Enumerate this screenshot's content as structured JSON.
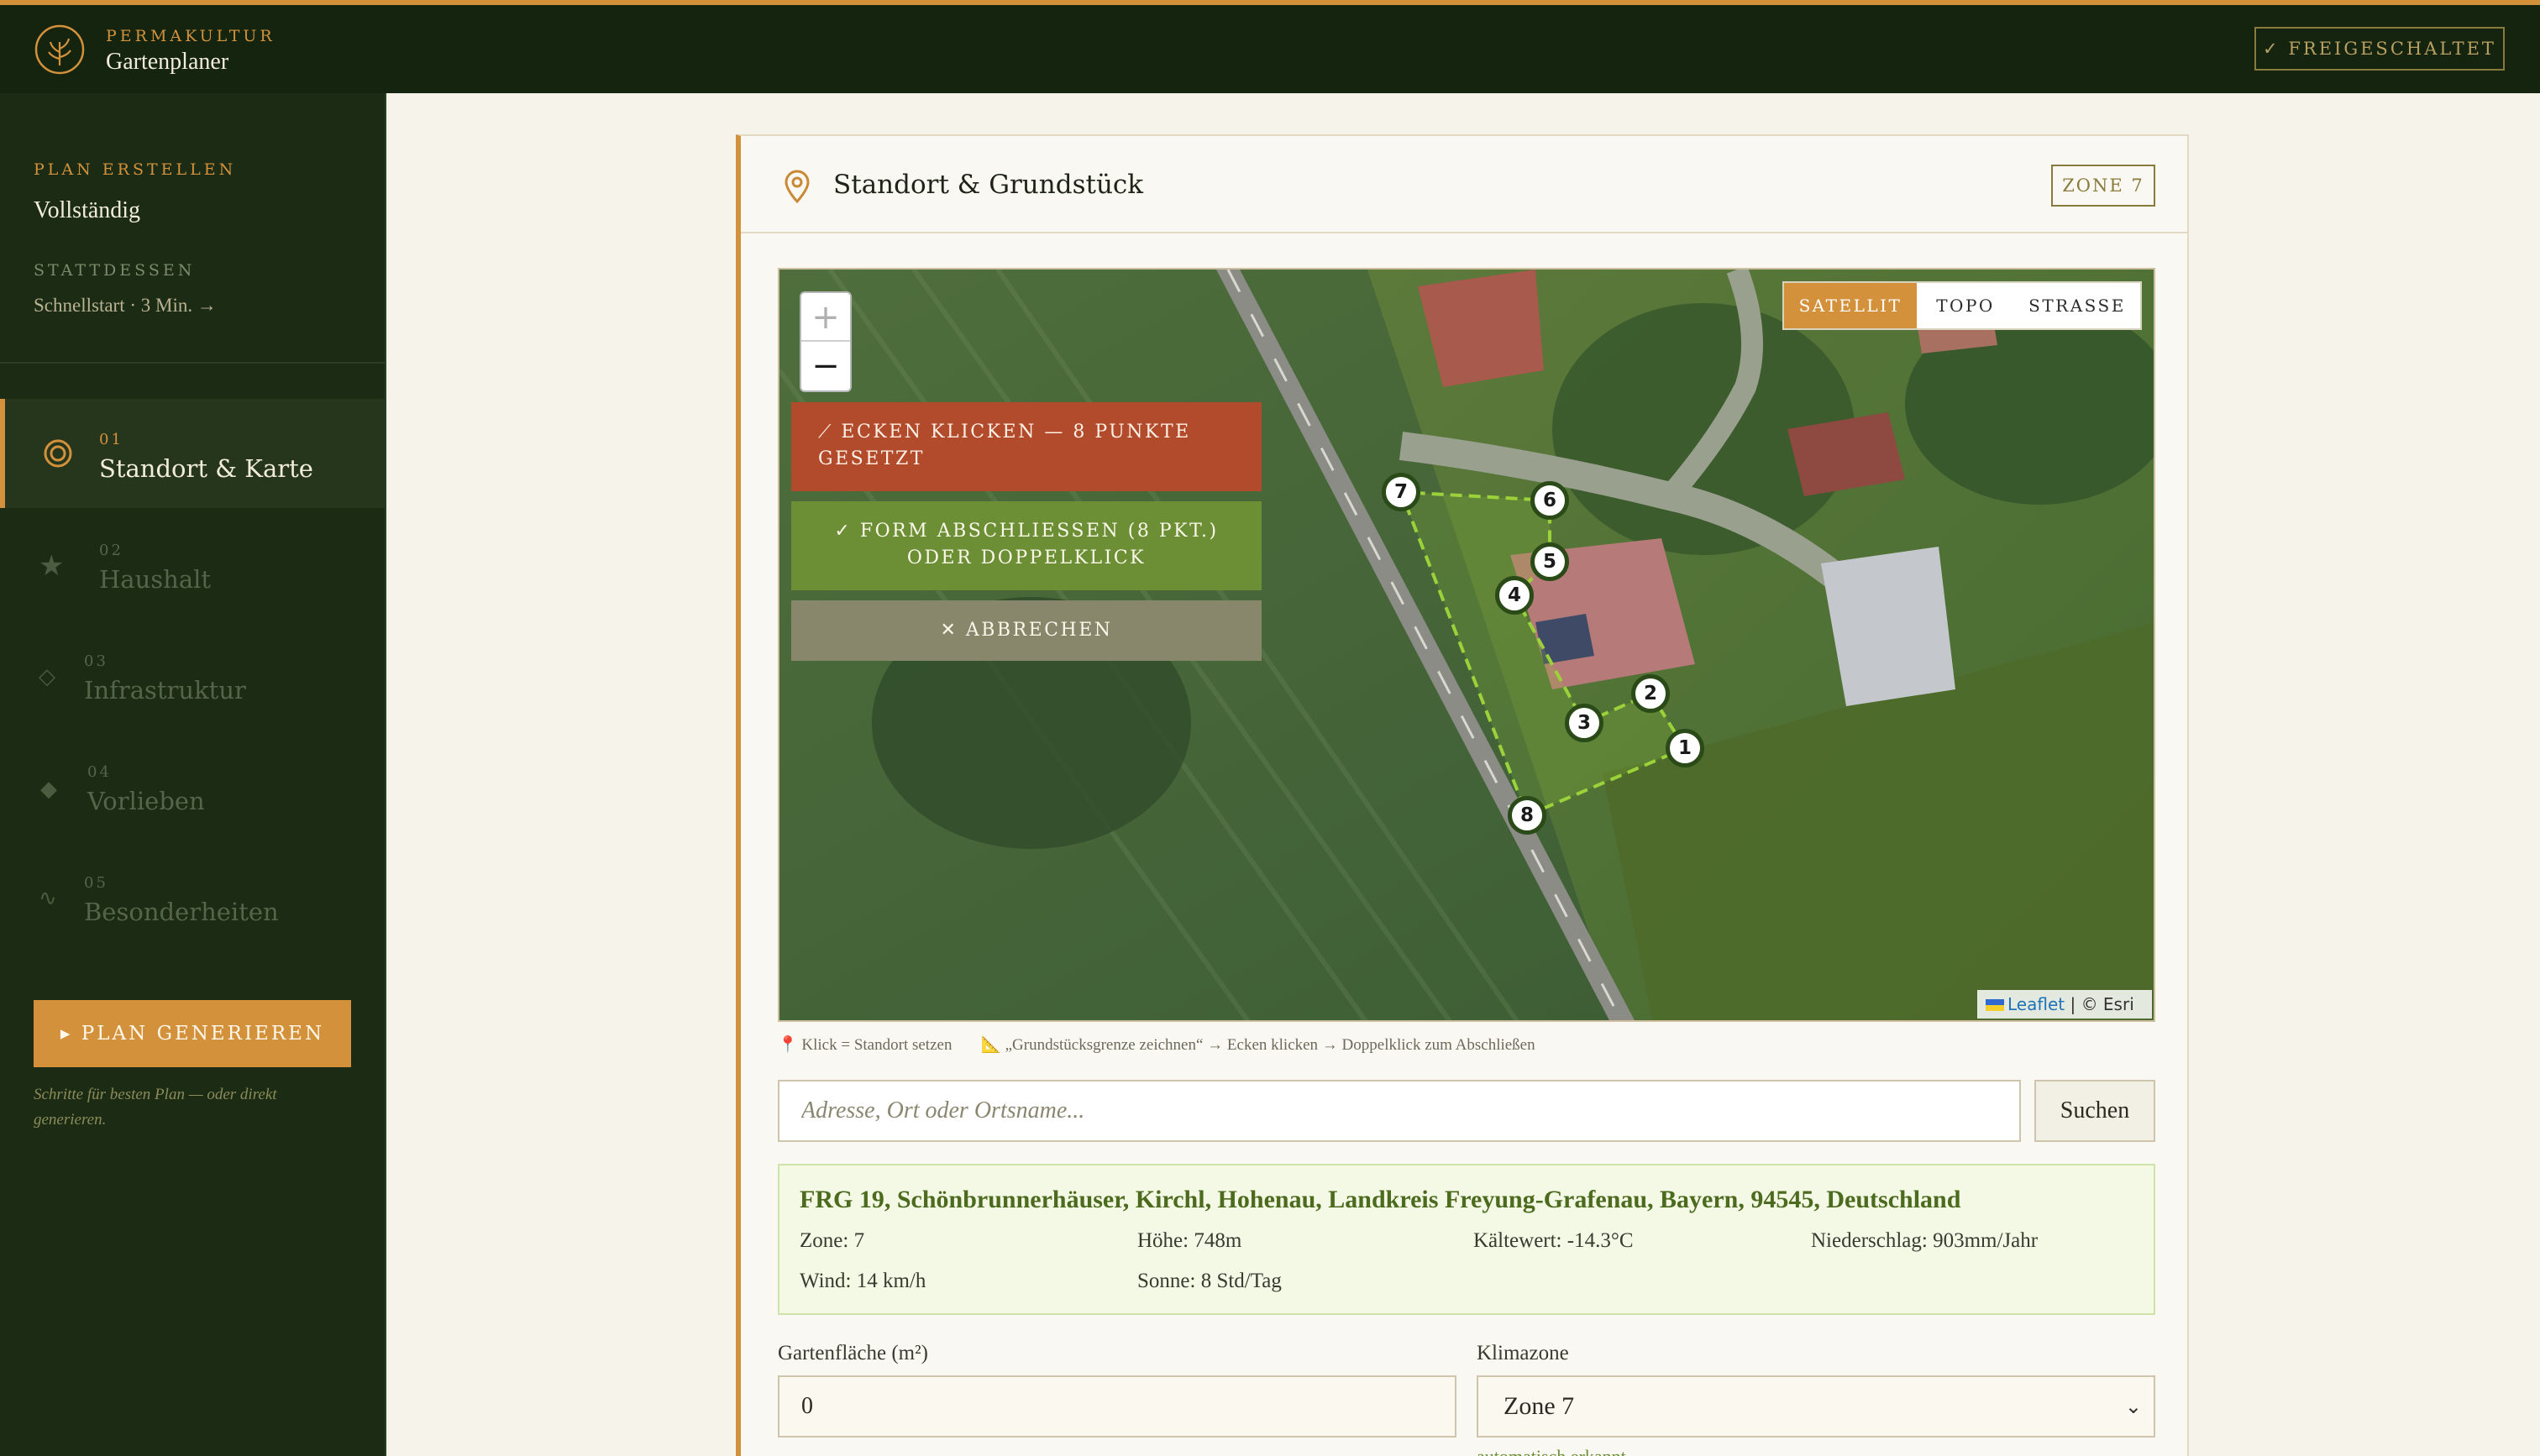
{
  "brand": {
    "tagline": "PERMAKULTUR",
    "name": "Gartenplaner",
    "status_badge": "✓ FREIGESCHALTET"
  },
  "sidebar": {
    "mode_label": "PLAN ERSTELLEN",
    "mode_value": "Vollständig",
    "alt_label": "STATTDESSEN",
    "alt_link": "Schnellstart · 3 Min. →",
    "steps": [
      {
        "num": "01",
        "label": "Standort & Karte",
        "icon": "target-icon",
        "active": true
      },
      {
        "num": "02",
        "label": "Haushalt",
        "icon": "star-icon",
        "active": false
      },
      {
        "num": "03",
        "label": "Infrastruktur",
        "icon": "diamond-outline-icon",
        "active": false
      },
      {
        "num": "04",
        "label": "Vorlieben",
        "icon": "diamond-filled-icon",
        "active": false
      },
      {
        "num": "05",
        "label": "Besonderheiten",
        "icon": "wave-icon",
        "active": false
      }
    ],
    "generate_button": "▸ PLAN GENERIEREN",
    "generate_note": "Schritte für besten Plan — oder direkt generieren."
  },
  "card": {
    "title": "Standort & Grundstück",
    "zone_badge": "ZONE 7"
  },
  "map": {
    "zoom_in": "+",
    "zoom_out": "−",
    "draw_message": "⟋ ECKEN KLICKEN — 8 PUNKTE GESETZT",
    "finish_button": "✓ FORM ABSCHLIESSEN (8 PKT.) ODER DOPPELKLICK",
    "cancel_button": "✕ ABBRECHEN",
    "layers": [
      "SATELLIT",
      "TOPO",
      "STRASSE"
    ],
    "active_layer": "SATELLIT",
    "attribution_leaflet": "Leaflet",
    "attribution_rest": " | © Esri",
    "markers": [
      "1",
      "2",
      "3",
      "4",
      "5",
      "6",
      "7",
      "8"
    ]
  },
  "hints": {
    "click": "📍 Klick = Standort setzen",
    "draw": "📐 „Grundstücksgrenze zeichnen“ → Ecken klicken → Doppelklick zum Abschließen"
  },
  "search": {
    "placeholder": "Adresse, Ort oder Ortsname...",
    "button": "Suchen"
  },
  "result": {
    "address": "FRG 19, Schönbrunnerhäuser, Kirchl, Hohenau, Landkreis Freyung-Grafenau, Bayern, 94545, Deutschland",
    "zone": "Zone: 7",
    "height": "Höhe: 748m",
    "cold": "Kältewert: -14.3°C",
    "rain": "Niederschlag: 903mm/Jahr",
    "wind": "Wind: 14 km/h",
    "sun": "Sonne: 8 Std/Tag"
  },
  "form": {
    "area_label": "Gartenfläche (m²)",
    "area_value": "0",
    "zone_label": "Klimazone",
    "zone_value": "Zone 7",
    "auto_note": "automatisch erkannt"
  },
  "colors": {
    "accent": "#d4913b",
    "sidebar_bg": "#1b2b14",
    "draw_red": "#b24a2c",
    "finish_green": "#6c8f36"
  }
}
